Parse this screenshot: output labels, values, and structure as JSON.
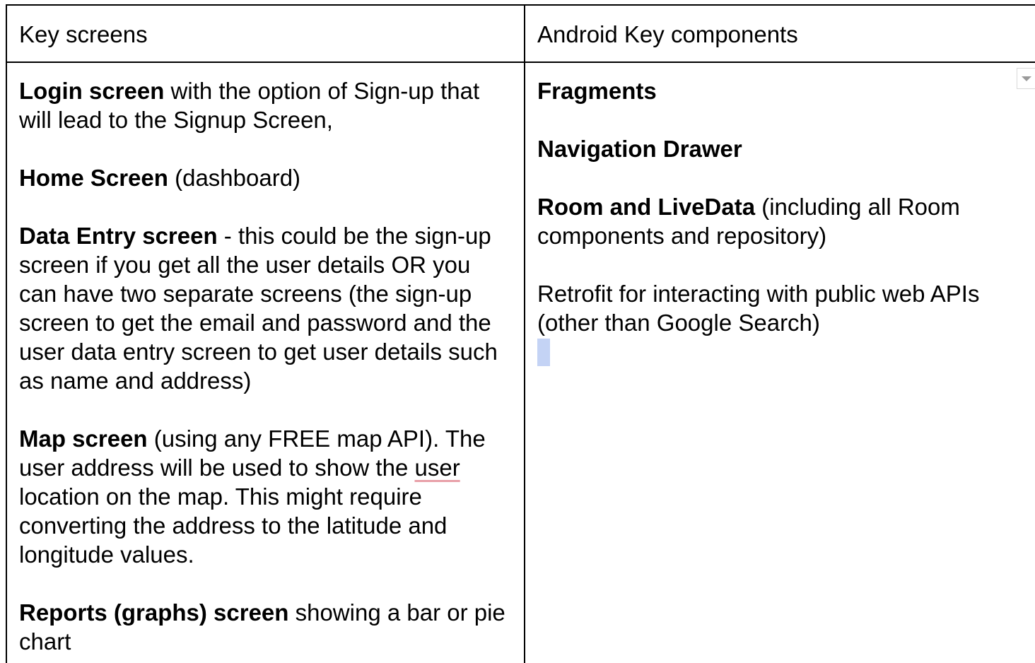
{
  "table": {
    "headers": {
      "col1": "Key screens",
      "col2": "Android Key components"
    },
    "col1": [
      {
        "bold": "Login screen",
        "rest": " with the option of Sign-up that will lead to the Signup Screen,"
      },
      {
        "bold": "Home Screen",
        "rest": " (dashboard)"
      },
      {
        "bold": "Data Entry screen",
        "rest": " - this could be the sign-up screen if you get all the user details OR you can have two separate screens (the sign-up screen to get the email and password and the user data entry screen to get user details such as name and address)"
      },
      {
        "bold": "Map screen",
        "rest": " (using any FREE map API). The user address will be used to show the ",
        "underlined": "user",
        "rest2": " location on the map. This might require converting the address to the latitude and longitude values."
      },
      {
        "bold": "Reports (graphs) screen",
        "rest": " showing a bar or pie chart"
      }
    ],
    "col2": [
      {
        "bold": "Fragments",
        "rest": ""
      },
      {
        "bold": "Navigation Drawer",
        "rest": ""
      },
      {
        "bold": "Room and LiveData",
        "rest": " (including all Room components and repository)"
      },
      {
        "bold": "",
        "rest": "Retrofit for interacting with public web APIs (other than Google Search)"
      }
    ]
  },
  "colors": {
    "border": "#000000",
    "cursor_highlight": "#c4d3f5",
    "spellcheck_underline": "#e8a0a8"
  },
  "icons": {
    "dropdown": "chevron-down-icon"
  }
}
